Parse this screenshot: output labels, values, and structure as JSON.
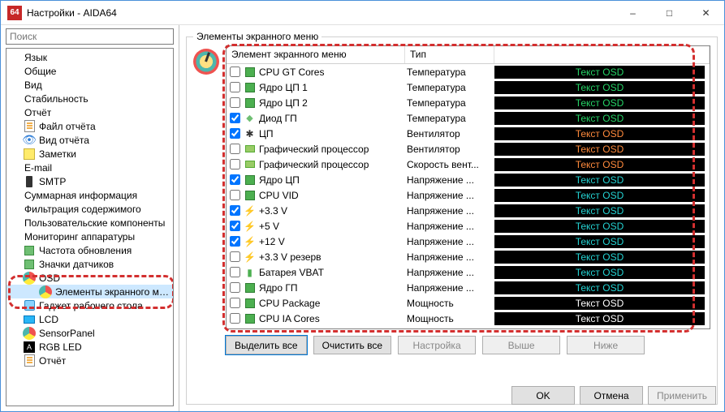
{
  "window": {
    "title": "Настройки - AIDA64",
    "icon_text": "64"
  },
  "search": {
    "placeholder": "Поиск"
  },
  "tree": [
    {
      "label": "Язык",
      "indent": 0,
      "icon": "",
      "sel": false
    },
    {
      "label": "Общие",
      "indent": 0,
      "icon": "",
      "sel": false
    },
    {
      "label": "Вид",
      "indent": 0,
      "icon": "",
      "sel": false
    },
    {
      "label": "Стабильность",
      "indent": 0,
      "icon": "",
      "sel": false
    },
    {
      "label": "Отчёт",
      "indent": 0,
      "icon": "",
      "sel": false
    },
    {
      "label": "Файл отчёта",
      "indent": 1,
      "icon": "doc",
      "sel": false
    },
    {
      "label": "Вид отчёта",
      "indent": 1,
      "icon": "eye",
      "sel": false
    },
    {
      "label": "Заметки",
      "indent": 1,
      "icon": "note",
      "sel": false
    },
    {
      "label": "E-mail",
      "indent": 0,
      "icon": "",
      "sel": false
    },
    {
      "label": "SMTP",
      "indent": 1,
      "icon": "phone",
      "sel": false
    },
    {
      "label": "Суммарная информация",
      "indent": 0,
      "icon": "",
      "sel": false
    },
    {
      "label": "Фильтрация содержимого",
      "indent": 0,
      "icon": "",
      "sel": false
    },
    {
      "label": "Пользовательские компоненты",
      "indent": 0,
      "icon": "",
      "sel": false
    },
    {
      "label": "Мониторинг аппаратуры",
      "indent": 0,
      "icon": "",
      "sel": false
    },
    {
      "label": "Частота обновления",
      "indent": 1,
      "icon": "chip",
      "sel": false
    },
    {
      "label": "Значки датчиков",
      "indent": 1,
      "icon": "chip",
      "sel": false
    },
    {
      "label": "OSD",
      "indent": 1,
      "icon": "osd",
      "sel": false
    },
    {
      "label": "Элементы экранного меню",
      "indent": 2,
      "icon": "osd",
      "sel": true
    },
    {
      "label": "Гаджет рабочего стола",
      "indent": 1,
      "icon": "gadget",
      "sel": false
    },
    {
      "label": "LCD",
      "indent": 1,
      "icon": "lcd",
      "sel": false
    },
    {
      "label": "SensorPanel",
      "indent": 1,
      "icon": "osd",
      "sel": false
    },
    {
      "label": "RGB LED",
      "indent": 1,
      "icon": "rgb",
      "sel": false
    },
    {
      "label": "Отчёт",
      "indent": 1,
      "icon": "doc",
      "sel": false
    }
  ],
  "group": {
    "legend": "Элементы экранного меню",
    "headers": {
      "item": "Элемент экранного меню",
      "type": "Тип",
      "osd": ""
    },
    "buttons": {
      "select_all": "Выделить все",
      "clear_all": "Очистить все",
      "configure": "Настройка",
      "up": "Выше",
      "down": "Ниже"
    }
  },
  "rows": [
    {
      "chk": false,
      "icon": "cpu",
      "label": "CPU GT Cores",
      "type": "Температура",
      "osd": "Текст OSD",
      "color": "#25d366"
    },
    {
      "chk": false,
      "icon": "cpu",
      "label": "Ядро ЦП 1",
      "type": "Температура",
      "osd": "Текст OSD",
      "color": "#25d366"
    },
    {
      "chk": false,
      "icon": "cpu",
      "label": "Ядро ЦП 2",
      "type": "Температура",
      "osd": "Текст OSD",
      "color": "#25d366"
    },
    {
      "chk": true,
      "icon": "diode",
      "label": "Диод ГП",
      "type": "Температура",
      "osd": "Текст OSD",
      "color": "#25d366"
    },
    {
      "chk": true,
      "icon": "fan",
      "label": "ЦП",
      "type": "Вентилятор",
      "osd": "Текст OSD",
      "color": "#ff8a3c"
    },
    {
      "chk": false,
      "icon": "gpu",
      "label": "Графический процессор",
      "type": "Вентилятор",
      "osd": "Текст OSD",
      "color": "#ff8a3c"
    },
    {
      "chk": false,
      "icon": "gpu",
      "label": "Графический процессор",
      "type": "Скорость вент...",
      "osd": "Текст OSD",
      "color": "#ff8a3c"
    },
    {
      "chk": true,
      "icon": "cpu",
      "label": "Ядро ЦП",
      "type": "Напряжение ...",
      "osd": "Текст OSD",
      "color": "#24d3d3"
    },
    {
      "chk": false,
      "icon": "cpu",
      "label": "CPU VID",
      "type": "Напряжение ...",
      "osd": "Текст OSD",
      "color": "#24d3d3"
    },
    {
      "chk": true,
      "icon": "volt",
      "label": "+3.3 V",
      "type": "Напряжение ...",
      "osd": "Текст OSD",
      "color": "#24d3d3"
    },
    {
      "chk": true,
      "icon": "volt",
      "label": "+5 V",
      "type": "Напряжение ...",
      "osd": "Текст OSD",
      "color": "#24d3d3"
    },
    {
      "chk": true,
      "icon": "volt",
      "label": "+12 V",
      "type": "Напряжение ...",
      "osd": "Текст OSD",
      "color": "#24d3d3"
    },
    {
      "chk": false,
      "icon": "volt",
      "label": "+3.3 V резерв",
      "type": "Напряжение ...",
      "osd": "Текст OSD",
      "color": "#24d3d3"
    },
    {
      "chk": false,
      "icon": "bat",
      "label": "Батарея VBAT",
      "type": "Напряжение ...",
      "osd": "Текст OSD",
      "color": "#24d3d3"
    },
    {
      "chk": false,
      "icon": "cpu",
      "label": "Ядро ГП",
      "type": "Напряжение ...",
      "osd": "Текст OSD",
      "color": "#24d3d3"
    },
    {
      "chk": false,
      "icon": "cpu",
      "label": "CPU Package",
      "type": "Мощность",
      "osd": "Текст OSD",
      "color": "#ffffff"
    },
    {
      "chk": false,
      "icon": "cpu",
      "label": "CPU IA Cores",
      "type": "Мощность",
      "osd": "Текст OSD",
      "color": "#ffffff"
    }
  ],
  "dialog_buttons": {
    "ok": "OK",
    "cancel": "Отмена",
    "apply": "Применить"
  }
}
